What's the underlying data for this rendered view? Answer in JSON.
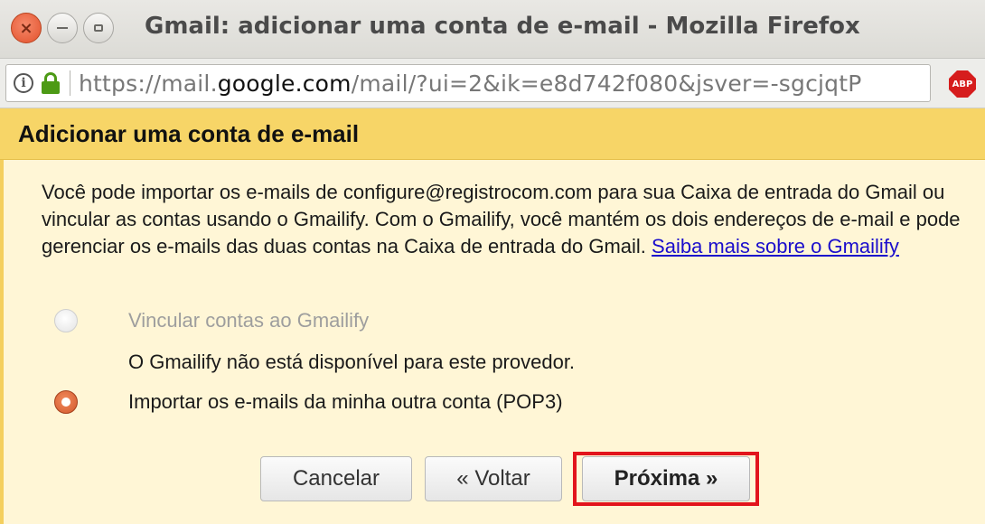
{
  "window": {
    "title": "Gmail: adicionar uma conta de e-mail - Mozilla Firefox",
    "close_glyph": "×"
  },
  "urlbar": {
    "prefix": "https://mail.",
    "domain": "google.com",
    "path": "/mail/?ui=2&ik=e8d742f080&jsver=-sgcjqtP",
    "info_glyph": "i",
    "abp_label": "ABP"
  },
  "dialog": {
    "title": "Adicionar uma conta de e-mail",
    "description": "Você pode importar os e-mails de configure@registrocom.com para sua Caixa de entrada do Gmail ou vincular as contas usando o Gmailify. Com o Gmailify, você mantém os dois endereços de e-mail e pode gerenciar os e-mails das duas contas na Caixa de entrada do Gmail.",
    "learn_more_link": "Saiba mais sobre o Gmailify",
    "options": [
      {
        "label": "Vincular contas ao Gmailify",
        "state": "disabled"
      },
      {
        "label": "Importar os e-mails da minha outra conta (POP3)",
        "state": "checked"
      }
    ],
    "unavailable_note": "O Gmailify não está disponível para este provedor.",
    "buttons": {
      "cancel": "Cancelar",
      "back": "« Voltar",
      "next": "Próxima »"
    }
  },
  "colors": {
    "header_bg": "#f7d567",
    "dialog_bg": "#fff6d6",
    "highlight": "#e2141c",
    "link": "#1a0dcc",
    "lock": "#4c9a15"
  }
}
